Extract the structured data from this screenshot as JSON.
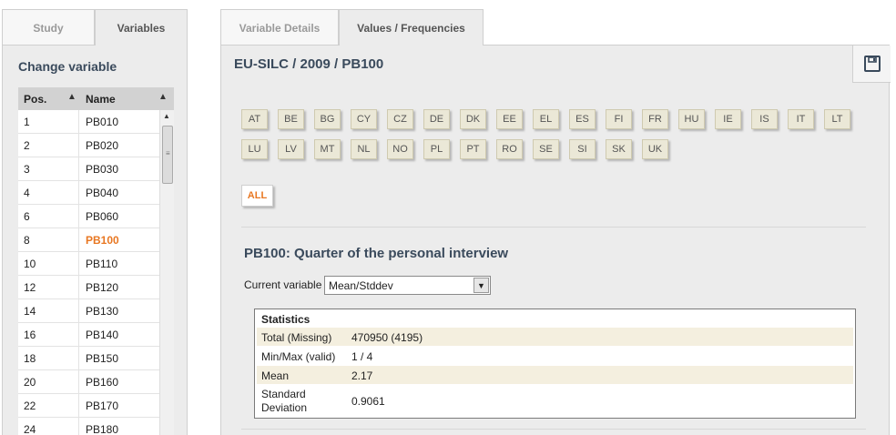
{
  "left_tabs": {
    "study": "Study",
    "variables": "Variables"
  },
  "change_variable": "Change variable",
  "variable_table": {
    "headers": {
      "pos": "Pos.",
      "name": "Name"
    },
    "rows": [
      {
        "pos": "1",
        "name": "PB010"
      },
      {
        "pos": "2",
        "name": "PB020"
      },
      {
        "pos": "3",
        "name": "PB030"
      },
      {
        "pos": "4",
        "name": "PB040"
      },
      {
        "pos": "6",
        "name": "PB060"
      },
      {
        "pos": "8",
        "name": "PB100"
      },
      {
        "pos": "10",
        "name": "PB110"
      },
      {
        "pos": "12",
        "name": "PB120"
      },
      {
        "pos": "14",
        "name": "PB130"
      },
      {
        "pos": "16",
        "name": "PB140"
      },
      {
        "pos": "18",
        "name": "PB150"
      },
      {
        "pos": "20",
        "name": "PB160"
      },
      {
        "pos": "22",
        "name": "PB170"
      },
      {
        "pos": "24",
        "name": "PB180"
      }
    ],
    "selected_name": "PB100"
  },
  "right_tabs": {
    "details": "Variable Details",
    "values": "Values / Frequencies"
  },
  "breadcrumb": "EU-SILC / 2009 / PB100",
  "countries": [
    "AT",
    "BE",
    "BG",
    "CY",
    "CZ",
    "DE",
    "DK",
    "EE",
    "EL",
    "ES",
    "FI",
    "FR",
    "HU",
    "IE",
    "IS",
    "IT",
    "LT",
    "LU",
    "LV",
    "MT",
    "NL",
    "NO",
    "PL",
    "PT",
    "RO",
    "SE",
    "SI",
    "SK",
    "UK"
  ],
  "all_label": "ALL",
  "variable_title": "PB100: Quarter of the personal interview",
  "current_variable_label": "Current variable",
  "current_variable_value": "Mean/Stddev",
  "statistics": {
    "title": "Statistics",
    "rows": [
      {
        "label": "Total (Missing)",
        "value": "470950 (4195)"
      },
      {
        "label": "Min/Max (valid)",
        "value": "1 / 4"
      },
      {
        "label": "Mean",
        "value": "2.17"
      },
      {
        "label": "Standard\nDeviation",
        "value": "0.9061"
      }
    ]
  },
  "colors": {
    "accent": "#e87722",
    "title": "#3a4a5c",
    "button_bg": "#ebe8d7"
  }
}
